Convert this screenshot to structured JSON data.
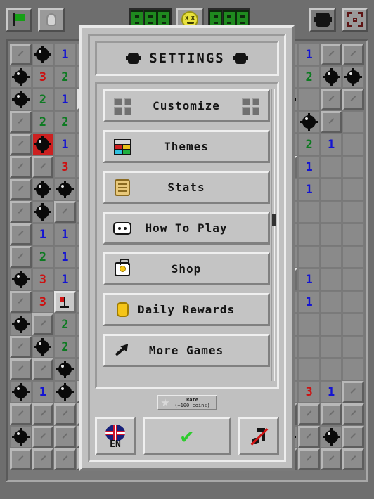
{
  "toolbar": {
    "flag_label": "flag-toggle",
    "hint_label": "hint-bulb",
    "mines_digits": [
      "8",
      "0",
      "8"
    ],
    "timer_digits": [
      "0",
      "8",
      "0"
    ],
    "face_state": "dead",
    "settings_label": "settings",
    "fullscreen_label": "fullscreen"
  },
  "dialog": {
    "title": "SETTINGS",
    "menu": [
      {
        "label": "Customize",
        "icon": "grid-icon"
      },
      {
        "label": "Themes",
        "icon": "palette-icon"
      },
      {
        "label": "Stats",
        "icon": "scroll-icon"
      },
      {
        "label": "How To Play",
        "icon": "controller-icon"
      },
      {
        "label": "Shop",
        "icon": "bag-icon"
      },
      {
        "label": "Daily Rewards",
        "icon": "coin-icon"
      },
      {
        "label": "More Games",
        "icon": "arrow-out-icon"
      }
    ],
    "rate": {
      "title": "Rate",
      "reward": "(+100 coins)"
    },
    "footer": {
      "language": "EN",
      "confirm": "✔",
      "music_state": "muted"
    }
  },
  "board": {
    "rows": [
      [
        "h",
        "m",
        "1",
        "e",
        "e",
        "e",
        "e",
        "e",
        "e",
        "e",
        "e",
        "e",
        "e",
        "1",
        "h",
        "h"
      ],
      [
        "m",
        "3",
        "2",
        "1",
        "e",
        "e",
        "e",
        "e",
        "e",
        "e",
        "e",
        "e",
        "e",
        "2",
        "m",
        "m"
      ],
      [
        "m",
        "2",
        "1",
        "F",
        "e",
        "e",
        "e",
        "e",
        "e",
        "e",
        "e",
        "e",
        "m",
        "e",
        "h",
        "h"
      ],
      [
        "h",
        "2",
        "2",
        "1",
        "e",
        "e",
        "e",
        "e",
        "e",
        "e",
        "e",
        "1",
        "2",
        "m",
        "h",
        "e"
      ],
      [
        "h",
        "B",
        "1",
        "e",
        "e",
        "e",
        "e",
        "e",
        "e",
        "e",
        "e",
        "1",
        "2",
        "2",
        "1",
        "e"
      ],
      [
        "h",
        "h",
        "3",
        "1",
        "e",
        "e",
        "e",
        "e",
        "e",
        "e",
        "e",
        "2",
        "F",
        "1",
        "e",
        "e"
      ],
      [
        "h",
        "m",
        "m",
        "1",
        "e",
        "e",
        "e",
        "e",
        "e",
        "e",
        "e",
        "2",
        "1",
        "1",
        "e",
        "e"
      ],
      [
        "h",
        "m",
        "h",
        "2",
        "e",
        "e",
        "e",
        "e",
        "e",
        "e",
        "e",
        "2",
        "1",
        "e",
        "e",
        "e"
      ],
      [
        "h",
        "1",
        "1",
        "1",
        "e",
        "e",
        "e",
        "e",
        "e",
        "e",
        "e",
        "1",
        "e",
        "e",
        "e",
        "e"
      ],
      [
        "h",
        "2",
        "1",
        "e",
        "e",
        "e",
        "e",
        "e",
        "e",
        "e",
        "e",
        "1",
        "1",
        "e",
        "e",
        "e"
      ],
      [
        "m",
        "3",
        "1",
        "e",
        "e",
        "e",
        "e",
        "e",
        "e",
        "e",
        "e",
        "1",
        "F",
        "1",
        "e",
        "e"
      ],
      [
        "h",
        "3",
        "F",
        "1",
        "e",
        "e",
        "e",
        "e",
        "e",
        "e",
        "e",
        "2",
        "2",
        "1",
        "e",
        "e"
      ],
      [
        "m",
        "h",
        "2",
        "1",
        "e",
        "e",
        "e",
        "e",
        "e",
        "e",
        "e",
        "1",
        "1",
        "e",
        "e",
        "e"
      ],
      [
        "h",
        "m",
        "2",
        "2",
        "e",
        "e",
        "e",
        "e",
        "e",
        "e",
        "e",
        "1",
        "e",
        "e",
        "e",
        "e"
      ],
      [
        "h",
        "h",
        "m",
        "1",
        "e",
        "e",
        "e",
        "e",
        "e",
        "e",
        "e",
        "2",
        "2",
        "e",
        "e",
        "e"
      ],
      [
        "m",
        "1",
        "m",
        "h",
        "e",
        "e",
        "e",
        "e",
        "e",
        "e",
        "e",
        "m",
        "1",
        "3",
        "1",
        "h"
      ],
      [
        "h",
        "h",
        "h",
        "h",
        "e",
        "e",
        "e",
        "e",
        "e",
        "e",
        "e",
        "h",
        "h",
        "h",
        "h",
        "h"
      ],
      [
        "m",
        "h",
        "h",
        "h",
        "e",
        "e",
        "e",
        "e",
        "e",
        "e",
        "e",
        "h",
        "m",
        "h",
        "m",
        "h"
      ],
      [
        "h",
        "h",
        "h",
        "h",
        "h",
        "h",
        "m",
        "h",
        "m",
        "h",
        "m",
        "h",
        "h",
        "h",
        "h",
        "h"
      ]
    ]
  },
  "colors": {
    "accent_green": "#16a016",
    "mine_red": "#cc2020",
    "n1": "#1414d2",
    "n2": "#0e7a22",
    "n3": "#cc1111",
    "coin_yellow": "#f5c518",
    "dialog_bg": "#c0c0c0"
  }
}
